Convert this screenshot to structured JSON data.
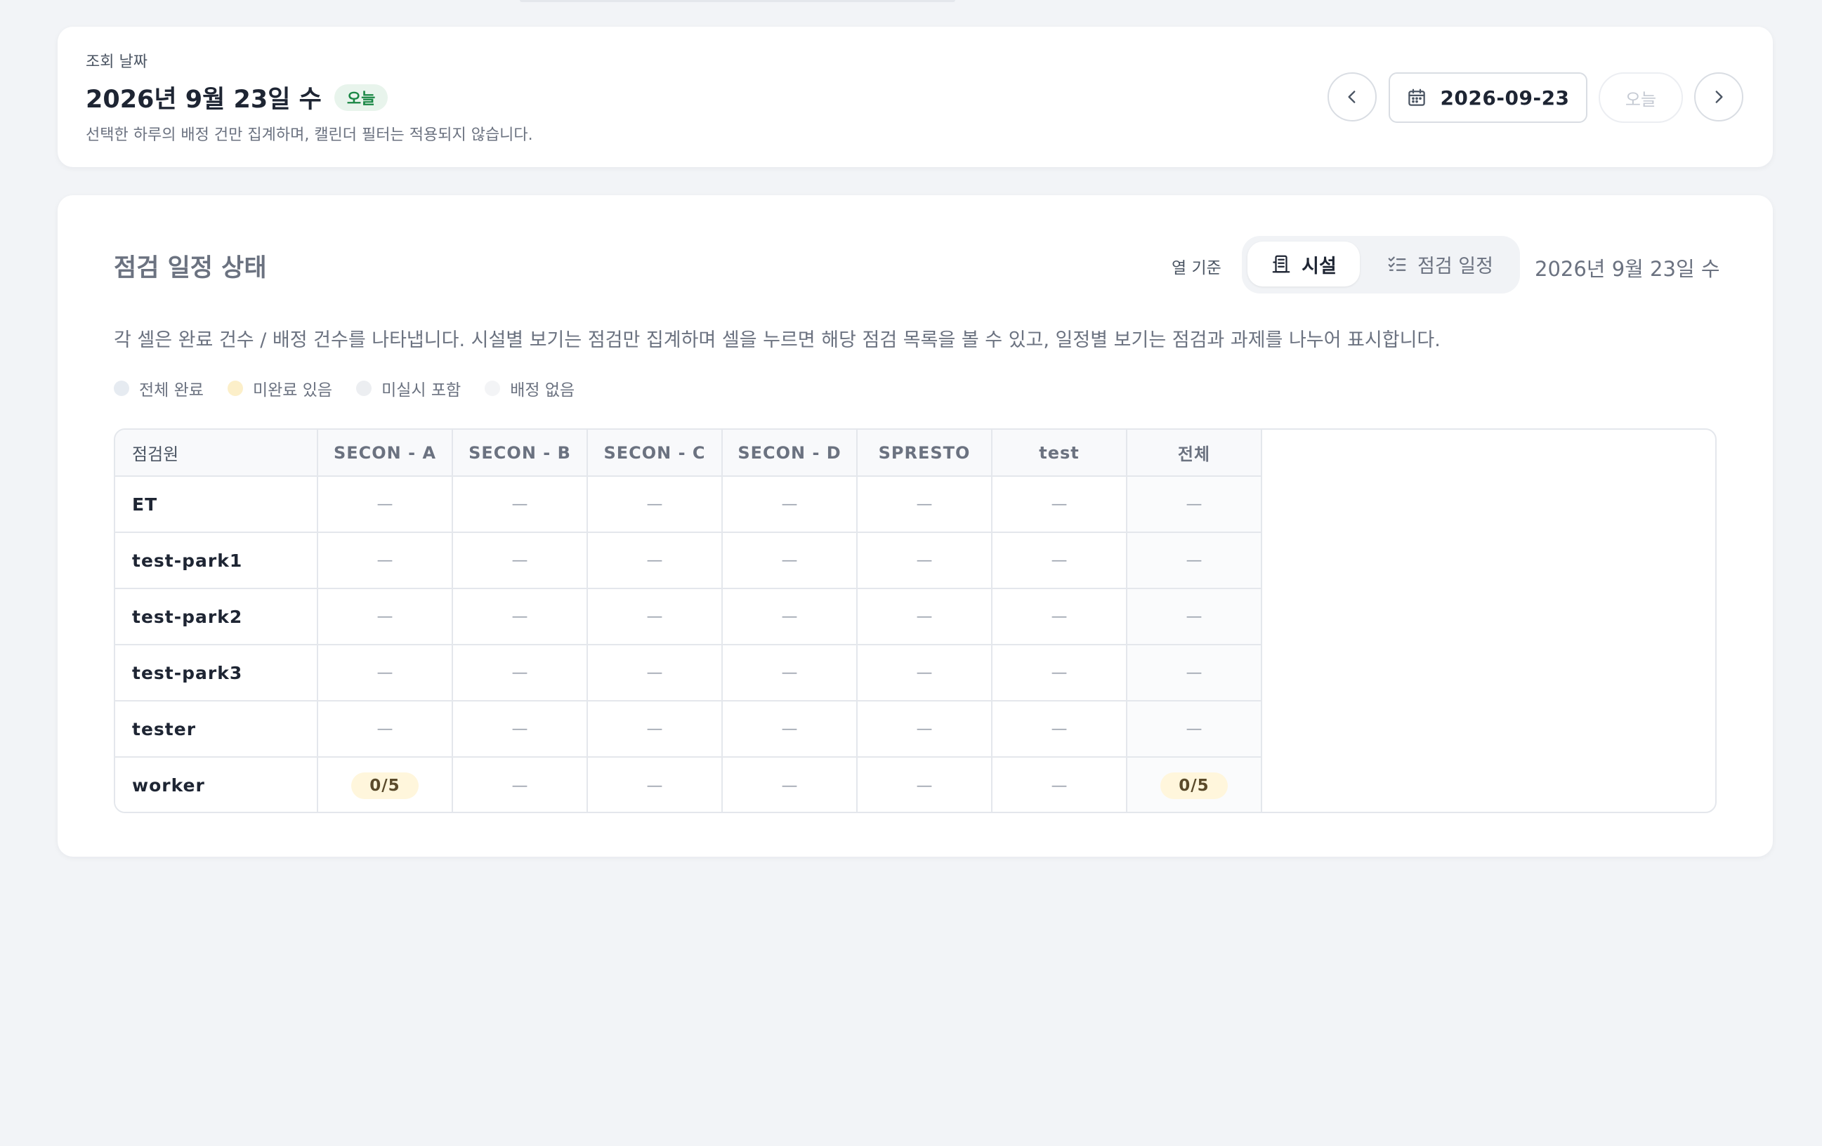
{
  "date_card": {
    "label": "조회 날짜",
    "title": "2026년 9월 23일 수",
    "today_badge": "오늘",
    "description": "선택한 하루의 배정 건만 집계하며, 캘린더 필터는 적용되지 않습니다.",
    "date_value": "2026-09-23",
    "today_button": "오늘",
    "icons": {
      "prev": "chevron-left-icon",
      "next": "chevron-right-icon",
      "calendar": "calendar-icon"
    }
  },
  "status_card": {
    "title": "점검 일정 상태",
    "column_basis_label": "열 기준",
    "toggle": {
      "facility": "시설",
      "schedule": "점검 일정",
      "selected": "facility"
    },
    "date_text": "2026년 9월 23일 수",
    "description": "각 셀은 완료 건수 / 배정 건수를 나타냅니다. 시설별 보기는 점검만 집계하며 셀을 누르면 해당 점검 목록을 볼 수 있고, 일정별 보기는 점검과 과제를 나누어 표시합니다.",
    "legend": [
      {
        "label": "전체 완료",
        "color": "#e6ebf1"
      },
      {
        "label": "미완료 있음",
        "color": "#fcefc9"
      },
      {
        "label": "미실시 포함",
        "color": "#eceef1"
      },
      {
        "label": "배정 없음",
        "color": "#f3f4f6"
      }
    ]
  },
  "table": {
    "headers": [
      "점검원",
      "SECON - A",
      "SECON - B",
      "SECON - C",
      "SECON - D",
      "SPRESTO",
      "test",
      "전체"
    ],
    "rows": [
      {
        "name": "ET",
        "cells": [
          "—",
          "—",
          "—",
          "—",
          "—",
          "—",
          "—"
        ]
      },
      {
        "name": "test-park1",
        "cells": [
          "—",
          "—",
          "—",
          "—",
          "—",
          "—",
          "—"
        ]
      },
      {
        "name": "test-park2",
        "cells": [
          "—",
          "—",
          "—",
          "—",
          "—",
          "—",
          "—"
        ]
      },
      {
        "name": "test-park3",
        "cells": [
          "—",
          "—",
          "—",
          "—",
          "—",
          "—",
          "—"
        ]
      },
      {
        "name": "tester",
        "cells": [
          "—",
          "—",
          "—",
          "—",
          "—",
          "—",
          "—"
        ]
      },
      {
        "name": "worker",
        "cells": [
          "0/5",
          "—",
          "—",
          "—",
          "—",
          "—",
          "0/5"
        ]
      }
    ]
  }
}
